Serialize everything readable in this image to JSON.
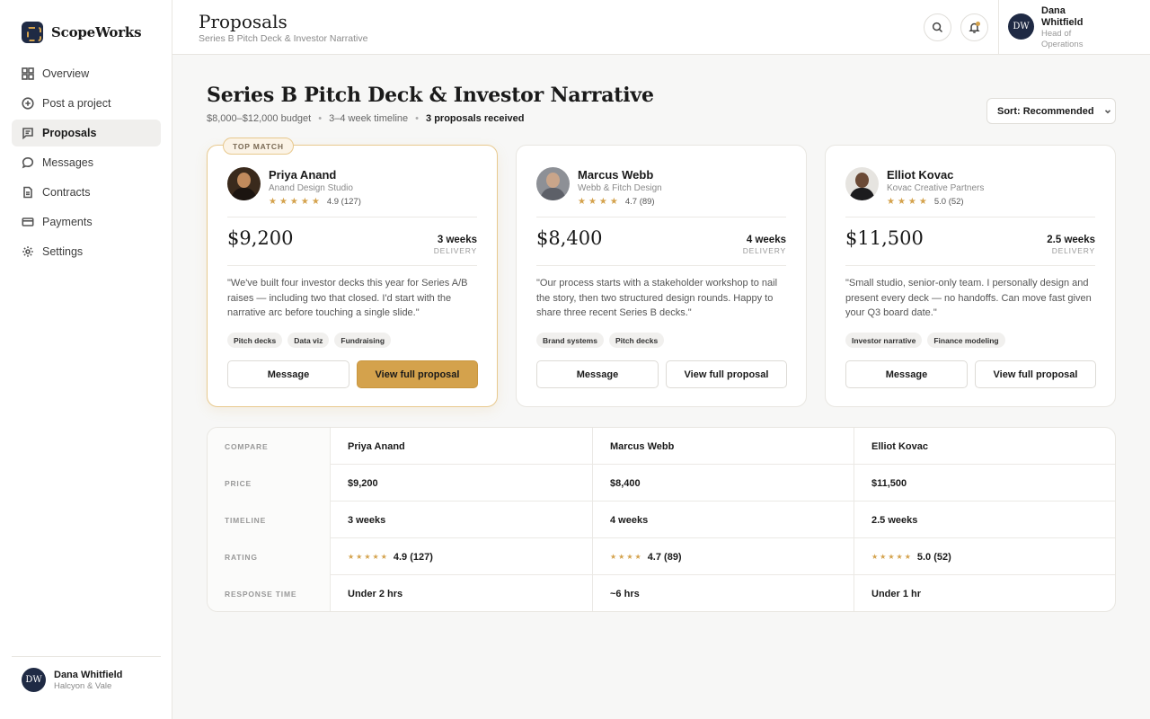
{
  "brand": {
    "name": "ScopeWorks"
  },
  "sidebar": {
    "items": [
      {
        "label": "Overview",
        "icon": "grid-icon"
      },
      {
        "label": "Post a project",
        "icon": "plus-circle-icon"
      },
      {
        "label": "Proposals",
        "icon": "proposal-icon",
        "active": true
      },
      {
        "label": "Messages",
        "icon": "chat-bubble-icon"
      },
      {
        "label": "Contracts",
        "icon": "document-icon"
      },
      {
        "label": "Payments",
        "icon": "credit-card-icon"
      },
      {
        "label": "Settings",
        "icon": "gear-icon"
      }
    ],
    "user": {
      "initials": "DW",
      "name": "Dana Whitfield",
      "company": "Halcyon & Vale"
    }
  },
  "header": {
    "title": "Proposals",
    "subtitle": "Series B Pitch Deck & Investor Narrative",
    "user": {
      "initials": "DW",
      "name": "Dana Whitfield",
      "role": "Head of Operations"
    }
  },
  "project": {
    "title": "Series B Pitch Deck & Investor Narrative",
    "budget": "$8,000–$12,000 budget",
    "timeline": "3–4 week timeline",
    "proposals_count": "3 proposals received",
    "sort_label": "Sort: Recommended"
  },
  "proposals": [
    {
      "badge": "TOP MATCH",
      "name": "Priya Anand",
      "studio": "Anand Design Studio",
      "stars": "★★★★★",
      "rating": "4.9 (127)",
      "price": "$9,200",
      "delivery": "3 weeks",
      "delivery_label": "DELIVERY",
      "quote": "\"We've built four investor decks this year for Series A/B raises — including two that closed. I'd start with the narrative arc before touching a single slide.\"",
      "tags": [
        "Pitch decks",
        "Data viz",
        "Fundraising"
      ],
      "message_label": "Message",
      "view_label": "View full proposal"
    },
    {
      "name": "Marcus Webb",
      "studio": "Webb & Fitch Design",
      "stars": "★★★★",
      "rating": "4.7 (89)",
      "price": "$8,400",
      "delivery": "4 weeks",
      "delivery_label": "DELIVERY",
      "quote": "\"Our process starts with a stakeholder workshop to nail the story, then two structured design rounds. Happy to share three recent Series B decks.\"",
      "tags": [
        "Brand systems",
        "Pitch decks"
      ],
      "message_label": "Message",
      "view_label": "View full proposal"
    },
    {
      "name": "Elliot Kovac",
      "studio": "Kovac Creative Partners",
      "stars": "★★★★",
      "rating": "5.0 (52)",
      "price": "$11,500",
      "delivery": "2.5 weeks",
      "delivery_label": "DELIVERY",
      "quote": "\"Small studio, senior-only team. I personally design and present every deck — no handoffs. Can move fast given your Q3 board date.\"",
      "tags": [
        "Investor narrative",
        "Finance modeling"
      ],
      "message_label": "Message",
      "view_label": "View full proposal"
    }
  ],
  "compare": {
    "header": [
      "COMPARE",
      "Priya Anand",
      "Marcus Webb",
      "Elliot Kovac"
    ],
    "rows": [
      [
        "PRICE",
        "$9,200",
        "$8,400",
        "$11,500"
      ],
      [
        "TIMELINE",
        "3 weeks",
        "4 weeks",
        "2.5 weeks"
      ],
      [
        "RATING",
        "4.9 (127)",
        "4.7 (89)",
        "5.0 (52)"
      ],
      [
        "RESPONSE TIME",
        "Under 2 hrs",
        "~6 hrs",
        "Under 1 hr"
      ]
    ],
    "rating_stars": [
      "★★★★★",
      "★★★★",
      "★★★★★"
    ]
  },
  "colors": {
    "accent": "#d4a24c",
    "navy": "#1f2a44"
  }
}
